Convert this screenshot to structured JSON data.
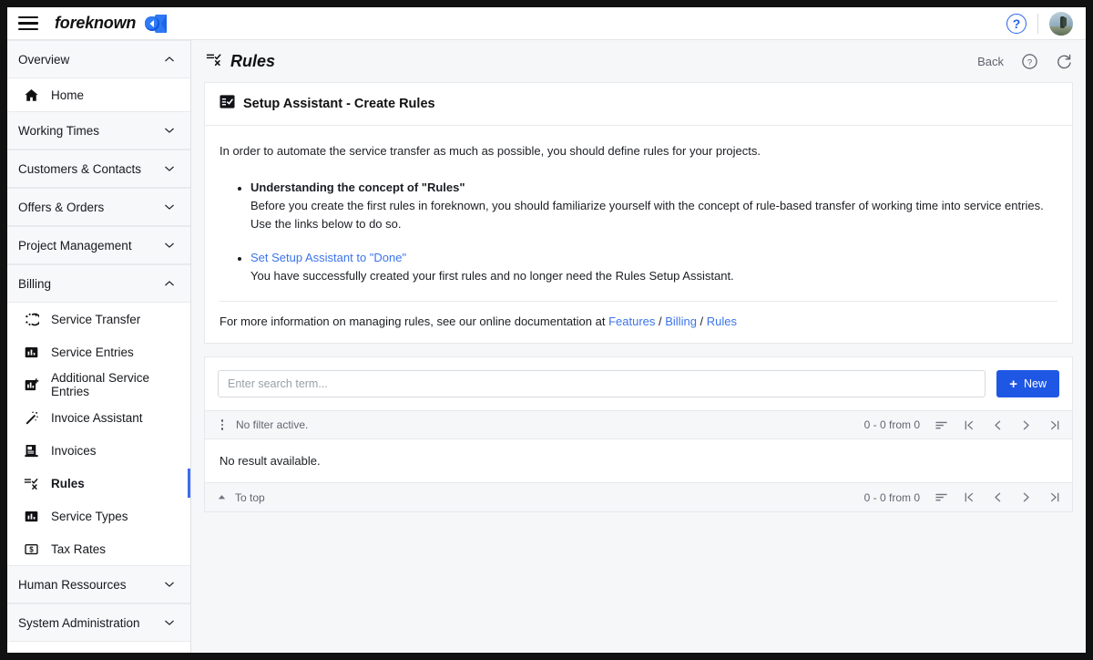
{
  "topbar": {
    "menu_icon": "hamburger-icon",
    "brand_name": "foreknown",
    "brand_logo_icon": "foreknown-logo-icon",
    "help_icon": "help-circle-icon",
    "help_label": "?",
    "avatar_icon": "user-avatar"
  },
  "sidebar": {
    "items": [
      {
        "label": "Overview",
        "type": "group",
        "icon": "chevron-up-icon",
        "expanded": true
      },
      {
        "label": "Home",
        "type": "item",
        "icon": "home-icon",
        "active": false
      },
      {
        "label": "Working Times",
        "type": "group",
        "icon": "chevron-down-icon",
        "expanded": false
      },
      {
        "label": "Customers & Contacts",
        "type": "group",
        "icon": "chevron-down-icon",
        "expanded": false
      },
      {
        "label": "Offers & Orders",
        "type": "group",
        "icon": "chevron-down-icon",
        "expanded": false
      },
      {
        "label": "Project Management",
        "type": "group",
        "icon": "chevron-down-icon",
        "expanded": false
      },
      {
        "label": "Billing",
        "type": "group",
        "icon": "chevron-up-icon",
        "expanded": true
      },
      {
        "label": "Service Transfer",
        "type": "item",
        "icon": "transfer-icon",
        "active": false
      },
      {
        "label": "Service Entries",
        "type": "item",
        "icon": "bar-chart-icon",
        "active": false
      },
      {
        "label": "Additional Service Entries",
        "type": "item",
        "icon": "bar-chart-plus-icon",
        "active": false
      },
      {
        "label": "Invoice Assistant",
        "type": "item",
        "icon": "magic-wand-icon",
        "active": false
      },
      {
        "label": "Invoices",
        "type": "item",
        "icon": "invoice-icon",
        "active": false
      },
      {
        "label": "Rules",
        "type": "item",
        "icon": "rules-icon",
        "active": true
      },
      {
        "label": "Service Types",
        "type": "item",
        "icon": "bar-chart-icon",
        "active": false
      },
      {
        "label": "Tax Rates",
        "type": "item",
        "icon": "money-icon",
        "active": false
      },
      {
        "label": "Human Ressources",
        "type": "group",
        "icon": "chevron-down-icon",
        "expanded": false
      },
      {
        "label": "System Administration",
        "type": "group",
        "icon": "chevron-down-icon",
        "expanded": false
      }
    ]
  },
  "page": {
    "title": "Rules",
    "title_icon": "rules-icon",
    "back_label": "Back",
    "help_icon": "help-circle-icon",
    "refresh_icon": "refresh-icon"
  },
  "setup_card": {
    "icon": "checklist-icon",
    "title": "Setup Assistant - Create Rules",
    "intro": "In order to automate the service transfer as much as possible, you should define rules for your projects.",
    "points": [
      {
        "title": "Understanding the concept of \"Rules\"",
        "is_link": false,
        "description": "Before you create the first rules in foreknown, you should familiarize yourself with the concept of rule-based transfer of working time into service entries. Use the links below to do so."
      },
      {
        "title": "Set Setup Assistant to \"Done\"",
        "is_link": true,
        "description": "You have successfully created your first rules and no longer need the Rules Setup Assistant."
      }
    ],
    "doc_prefix": "For more information on managing rules, see our online documentation at ",
    "doc_links": [
      "Features",
      "Billing",
      "Rules"
    ],
    "doc_separator": " / "
  },
  "list_card": {
    "search_placeholder": "Enter search term...",
    "search_value": "",
    "new_label": "New",
    "new_icon": "plus-icon",
    "filter_status": "No filter active.",
    "kebab_icon": "more-vertical-icon",
    "count_top": "0 - 0 from 0",
    "count_bottom": "0 - 0 from 0",
    "sort_icon": "sort-icon",
    "first_icon": "first-page-icon",
    "prev_icon": "previous-page-icon",
    "next_icon": "next-page-icon",
    "last_icon": "last-page-icon",
    "empty_message": "No result available.",
    "to_top_label": "To top",
    "to_top_icon": "caret-up-icon"
  },
  "colors": {
    "accent_blue": "#1f57e5",
    "link_blue": "#3b74ea",
    "active_border": "#3b6df0",
    "surface": "#f6f7f9"
  }
}
